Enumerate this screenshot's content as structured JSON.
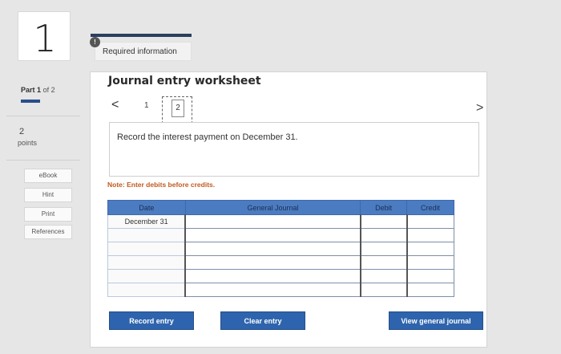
{
  "question": {
    "number": "1"
  },
  "part": {
    "label_prefix": "Part",
    "current": "1",
    "label_mid": "of",
    "total": "2"
  },
  "points": {
    "value": "2",
    "label": "points"
  },
  "sidebar": {
    "ebook": "eBook",
    "hint": "Hint",
    "print": "Print",
    "references": "References"
  },
  "required": {
    "badge": "!",
    "text": "Required information"
  },
  "worksheet": {
    "title": "Journal entry worksheet",
    "nav": {
      "prev": "<",
      "page1": "1",
      "page2": "2",
      "next": ">"
    },
    "instruction": "Record the interest payment on December 31.",
    "note": "Note: Enter debits before credits.",
    "table": {
      "headers": {
        "date": "Date",
        "journal": "General Journal",
        "debit": "Debit",
        "credit": "Credit"
      },
      "rows": [
        {
          "date": "December 31"
        },
        {
          "date": ""
        },
        {
          "date": ""
        },
        {
          "date": ""
        },
        {
          "date": ""
        },
        {
          "date": ""
        }
      ]
    },
    "buttons": {
      "record": "Record entry",
      "clear": "Clear entry",
      "view": "View general journal"
    }
  },
  "colors": {
    "accent": "#2e64ad",
    "header": "#4b7bc0",
    "note": "#c05a1e"
  }
}
